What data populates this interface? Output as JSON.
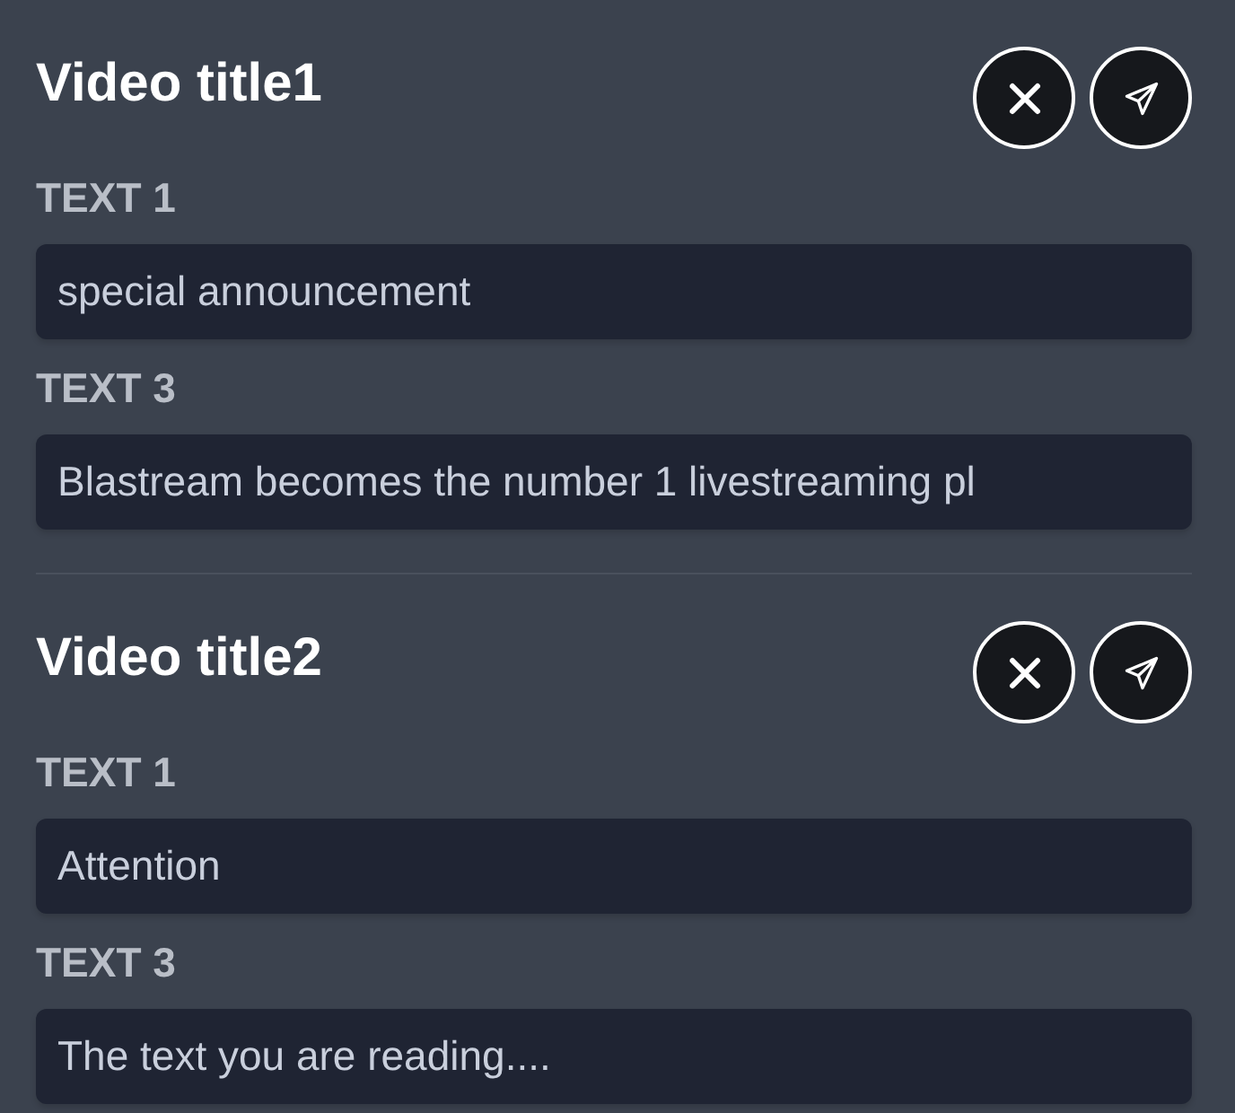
{
  "videos": [
    {
      "title": "Video title1",
      "fields": [
        {
          "label": "TEXT 1",
          "value": "special announcement"
        },
        {
          "label": "TEXT 3",
          "value": "Blastream becomes the number 1 livestreaming pl"
        }
      ]
    },
    {
      "title": "Video title2",
      "fields": [
        {
          "label": "TEXT 1",
          "value": "Attention"
        },
        {
          "label": "TEXT 3",
          "value": "The text you are reading...."
        }
      ]
    }
  ]
}
